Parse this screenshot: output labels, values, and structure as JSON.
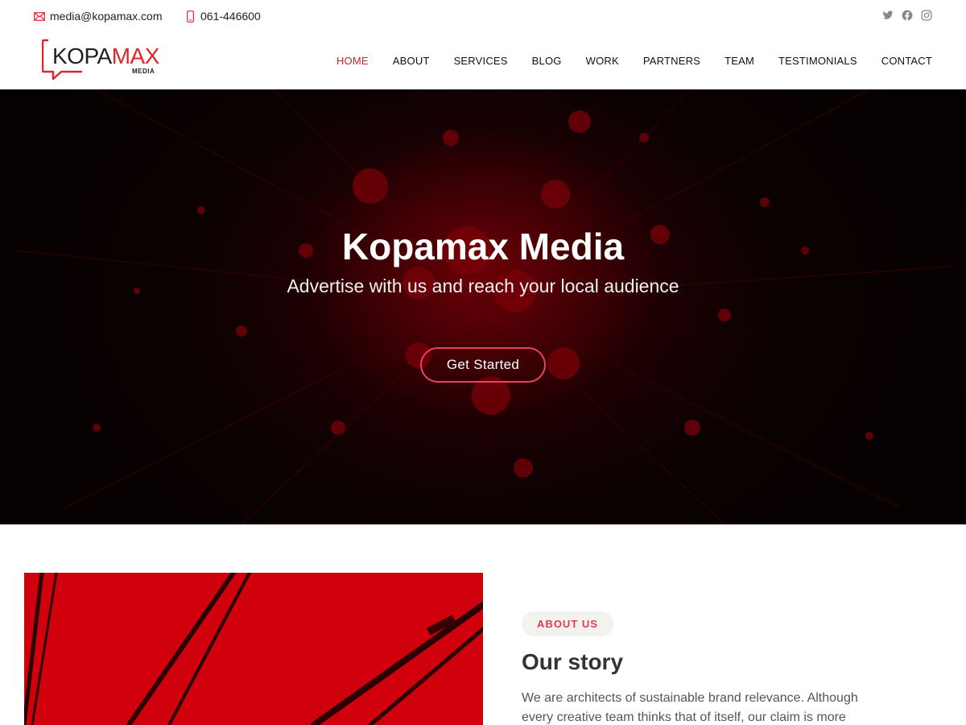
{
  "topbar": {
    "email": "media@kopamax.com",
    "phone": "061-446600",
    "socials": [
      "twitter-icon",
      "facebook-icon",
      "instagram-icon"
    ]
  },
  "header": {
    "logo": {
      "part1": "KOPA",
      "part2": "MAX",
      "sub": "MEDIA"
    },
    "nav": [
      {
        "label": "HOME",
        "active": true
      },
      {
        "label": "ABOUT"
      },
      {
        "label": "SERVICES"
      },
      {
        "label": "BLOG"
      },
      {
        "label": "WORK"
      },
      {
        "label": "PARTNERS"
      },
      {
        "label": "TEAM"
      },
      {
        "label": "TESTIMONIALS"
      },
      {
        "label": "CONTACT"
      }
    ]
  },
  "hero": {
    "title": "Kopamax Media",
    "subtitle": "Advertise with us and reach your local audience",
    "cta": "Get Started"
  },
  "about": {
    "badge": "ABOUT US",
    "title": "Our story",
    "text": "We are architects of sustainable brand relevance. Although every creative team thinks that of itself, our claim is more"
  },
  "colors": {
    "accent": "#c1272d",
    "logo_red": "#e0242b",
    "cta_border": "#e9415f",
    "badge_text": "#e43a59",
    "badge_bg": "#f1f3ec",
    "about_image_red": "#d0000d"
  }
}
